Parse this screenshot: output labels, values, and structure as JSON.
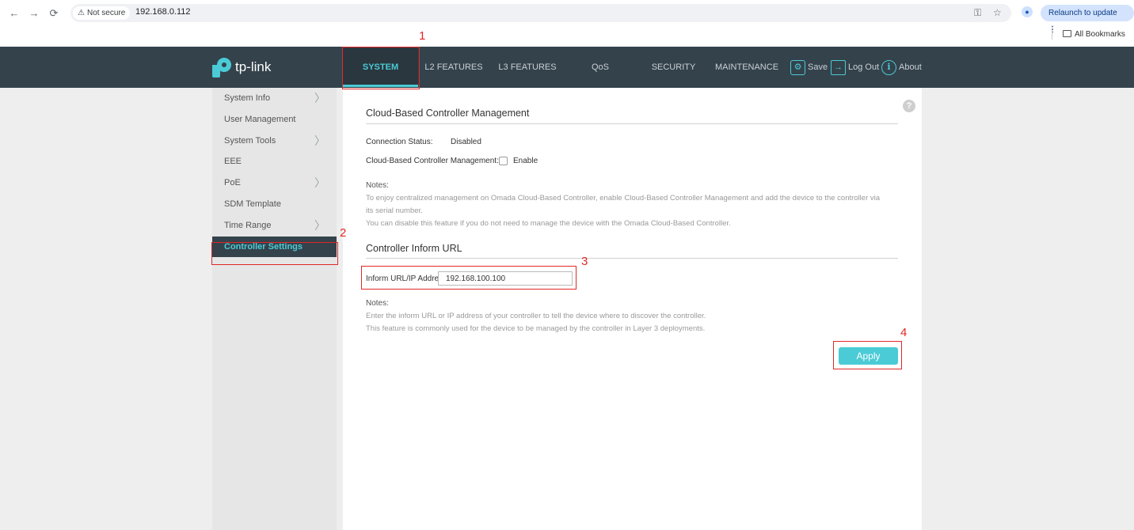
{
  "browser": {
    "security_label": "Not secure",
    "url": "192.168.0.112",
    "relaunch_label": "Relaunch to update",
    "bookmarks_label": "All Bookmarks"
  },
  "header": {
    "logo_text": "tp-link",
    "menu": [
      "SYSTEM",
      "L2 FEATURES",
      "L3 FEATURES",
      "QoS",
      "SECURITY",
      "MAINTENANCE"
    ],
    "active_menu": "SYSTEM",
    "save_label": "Save",
    "logout_label": "Log Out",
    "about_label": "About"
  },
  "sidebar": {
    "items": [
      {
        "label": "System Info",
        "has_submenu": true
      },
      {
        "label": "User Management",
        "has_submenu": false
      },
      {
        "label": "System Tools",
        "has_submenu": true
      },
      {
        "label": "EEE",
        "has_submenu": false
      },
      {
        "label": "PoE",
        "has_submenu": true
      },
      {
        "label": "SDM Template",
        "has_submenu": false
      },
      {
        "label": "Time Range",
        "has_submenu": true
      },
      {
        "label": "Controller Settings",
        "has_submenu": false
      }
    ],
    "active_item": "Controller Settings"
  },
  "main": {
    "cloud_section": {
      "title": "Cloud-Based Controller Management",
      "status_label": "Connection Status:",
      "status_value": "Disabled",
      "mgmt_label": "Cloud-Based Controller Management:",
      "enable_label": "Enable",
      "enable_checked": false,
      "notes_title": "Notes:",
      "notes": [
        "To enjoy centralized management on Omada Cloud-Based Controller, enable Cloud-Based Controller Management and add the device to the controller via",
        "its serial number.",
        "You can disable this feature if you do not need to manage the device with the Omada Cloud-Based Controller."
      ]
    },
    "inform_section": {
      "title": "Controller Inform URL",
      "url_label": "Inform URL/IP Address:",
      "url_value": "192.168.100.100",
      "notes_title": "Notes:",
      "notes": [
        "Enter the inform URL or IP address of your controller to tell the device where to discover the controller.",
        "This feature is commonly used for the device to be managed by the controller in Layer 3 deployments."
      ]
    },
    "apply_label": "Apply"
  },
  "annotations": [
    "1",
    "2",
    "3",
    "4"
  ],
  "colors": {
    "accent": "#4acbd6",
    "header_bg": "#34424b",
    "annotation": "#e12828"
  }
}
